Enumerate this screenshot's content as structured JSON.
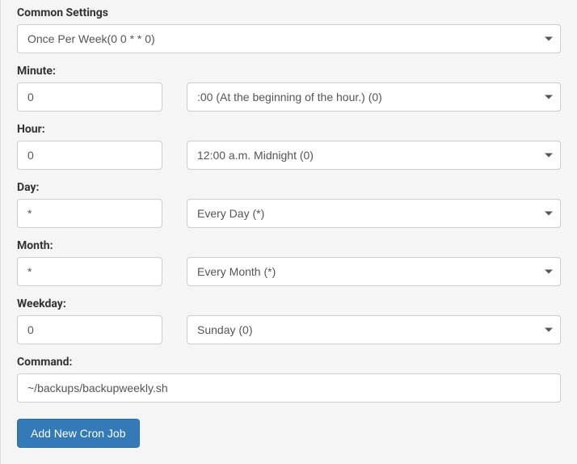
{
  "commonSettings": {
    "label": "Common Settings",
    "value": "Once Per Week(0 0 * * 0)"
  },
  "minute": {
    "label": "Minute:",
    "inputValue": "0",
    "selectValue": ":00 (At the beginning of the hour.) (0)"
  },
  "hour": {
    "label": "Hour:",
    "inputValue": "0",
    "selectValue": "12:00 a.m. Midnight (0)"
  },
  "day": {
    "label": "Day:",
    "inputValue": "*",
    "selectValue": "Every Day (*)"
  },
  "month": {
    "label": "Month:",
    "inputValue": "*",
    "selectValue": "Every Month (*)"
  },
  "weekday": {
    "label": "Weekday:",
    "inputValue": "0",
    "selectValue": "Sunday (0)"
  },
  "command": {
    "label": "Command:",
    "inputValue": "~/backups/backupweekly.sh"
  },
  "submitButton": {
    "label": "Add New Cron Job"
  }
}
